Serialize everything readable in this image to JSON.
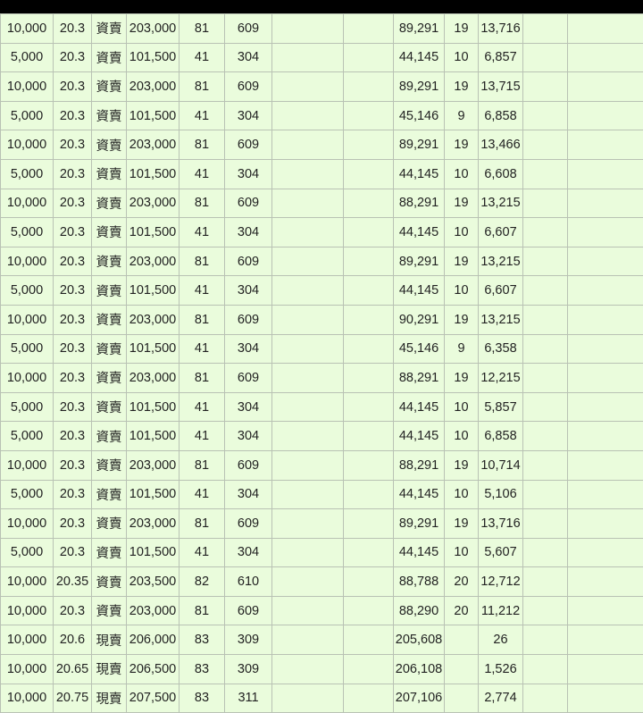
{
  "rows": [
    {
      "qty": "10,000",
      "price": "20.3",
      "type": "資賣",
      "amount": "203,000",
      "fee": "81",
      "tax": "609",
      "e1": "",
      "e2": "",
      "net": "89,291",
      "days": "19",
      "profit": "13,716",
      "e3": "",
      "e4": ""
    },
    {
      "qty": "5,000",
      "price": "20.3",
      "type": "資賣",
      "amount": "101,500",
      "fee": "41",
      "tax": "304",
      "e1": "",
      "e2": "",
      "net": "44,145",
      "days": "10",
      "profit": "6,857",
      "e3": "",
      "e4": ""
    },
    {
      "qty": "10,000",
      "price": "20.3",
      "type": "資賣",
      "amount": "203,000",
      "fee": "81",
      "tax": "609",
      "e1": "",
      "e2": "",
      "net": "89,291",
      "days": "19",
      "profit": "13,715",
      "e3": "",
      "e4": ""
    },
    {
      "qty": "5,000",
      "price": "20.3",
      "type": "資賣",
      "amount": "101,500",
      "fee": "41",
      "tax": "304",
      "e1": "",
      "e2": "",
      "net": "45,146",
      "days": "9",
      "profit": "6,858",
      "e3": "",
      "e4": ""
    },
    {
      "qty": "10,000",
      "price": "20.3",
      "type": "資賣",
      "amount": "203,000",
      "fee": "81",
      "tax": "609",
      "e1": "",
      "e2": "",
      "net": "89,291",
      "days": "19",
      "profit": "13,466",
      "e3": "",
      "e4": ""
    },
    {
      "qty": "5,000",
      "price": "20.3",
      "type": "資賣",
      "amount": "101,500",
      "fee": "41",
      "tax": "304",
      "e1": "",
      "e2": "",
      "net": "44,145",
      "days": "10",
      "profit": "6,608",
      "e3": "",
      "e4": ""
    },
    {
      "qty": "10,000",
      "price": "20.3",
      "type": "資賣",
      "amount": "203,000",
      "fee": "81",
      "tax": "609",
      "e1": "",
      "e2": "",
      "net": "88,291",
      "days": "19",
      "profit": "13,215",
      "e3": "",
      "e4": ""
    },
    {
      "qty": "5,000",
      "price": "20.3",
      "type": "資賣",
      "amount": "101,500",
      "fee": "41",
      "tax": "304",
      "e1": "",
      "e2": "",
      "net": "44,145",
      "days": "10",
      "profit": "6,607",
      "e3": "",
      "e4": ""
    },
    {
      "qty": "10,000",
      "price": "20.3",
      "type": "資賣",
      "amount": "203,000",
      "fee": "81",
      "tax": "609",
      "e1": "",
      "e2": "",
      "net": "89,291",
      "days": "19",
      "profit": "13,215",
      "e3": "",
      "e4": ""
    },
    {
      "qty": "5,000",
      "price": "20.3",
      "type": "資賣",
      "amount": "101,500",
      "fee": "41",
      "tax": "304",
      "e1": "",
      "e2": "",
      "net": "44,145",
      "days": "10",
      "profit": "6,607",
      "e3": "",
      "e4": ""
    },
    {
      "qty": "10,000",
      "price": "20.3",
      "type": "資賣",
      "amount": "203,000",
      "fee": "81",
      "tax": "609",
      "e1": "",
      "e2": "",
      "net": "90,291",
      "days": "19",
      "profit": "13,215",
      "e3": "",
      "e4": ""
    },
    {
      "qty": "5,000",
      "price": "20.3",
      "type": "資賣",
      "amount": "101,500",
      "fee": "41",
      "tax": "304",
      "e1": "",
      "e2": "",
      "net": "45,146",
      "days": "9",
      "profit": "6,358",
      "e3": "",
      "e4": ""
    },
    {
      "qty": "10,000",
      "price": "20.3",
      "type": "資賣",
      "amount": "203,000",
      "fee": "81",
      "tax": "609",
      "e1": "",
      "e2": "",
      "net": "88,291",
      "days": "19",
      "profit": "12,215",
      "e3": "",
      "e4": ""
    },
    {
      "qty": "5,000",
      "price": "20.3",
      "type": "資賣",
      "amount": "101,500",
      "fee": "41",
      "tax": "304",
      "e1": "",
      "e2": "",
      "net": "44,145",
      "days": "10",
      "profit": "5,857",
      "e3": "",
      "e4": ""
    },
    {
      "qty": "5,000",
      "price": "20.3",
      "type": "資賣",
      "amount": "101,500",
      "fee": "41",
      "tax": "304",
      "e1": "",
      "e2": "",
      "net": "44,145",
      "days": "10",
      "profit": "6,858",
      "e3": "",
      "e4": ""
    },
    {
      "qty": "10,000",
      "price": "20.3",
      "type": "資賣",
      "amount": "203,000",
      "fee": "81",
      "tax": "609",
      "e1": "",
      "e2": "",
      "net": "88,291",
      "days": "19",
      "profit": "10,714",
      "e3": "",
      "e4": ""
    },
    {
      "qty": "5,000",
      "price": "20.3",
      "type": "資賣",
      "amount": "101,500",
      "fee": "41",
      "tax": "304",
      "e1": "",
      "e2": "",
      "net": "44,145",
      "days": "10",
      "profit": "5,106",
      "e3": "",
      "e4": ""
    },
    {
      "qty": "10,000",
      "price": "20.3",
      "type": "資賣",
      "amount": "203,000",
      "fee": "81",
      "tax": "609",
      "e1": "",
      "e2": "",
      "net": "89,291",
      "days": "19",
      "profit": "13,716",
      "e3": "",
      "e4": ""
    },
    {
      "qty": "5,000",
      "price": "20.3",
      "type": "資賣",
      "amount": "101,500",
      "fee": "41",
      "tax": "304",
      "e1": "",
      "e2": "",
      "net": "44,145",
      "days": "10",
      "profit": "5,607",
      "e3": "",
      "e4": ""
    },
    {
      "qty": "10,000",
      "price": "20.35",
      "type": "資賣",
      "amount": "203,500",
      "fee": "82",
      "tax": "610",
      "e1": "",
      "e2": "",
      "net": "88,788",
      "days": "20",
      "profit": "12,712",
      "e3": "",
      "e4": ""
    },
    {
      "qty": "10,000",
      "price": "20.3",
      "type": "資賣",
      "amount": "203,000",
      "fee": "81",
      "tax": "609",
      "e1": "",
      "e2": "",
      "net": "88,290",
      "days": "20",
      "profit": "11,212",
      "e3": "",
      "e4": ""
    },
    {
      "qty": "10,000",
      "price": "20.6",
      "type": "現賣",
      "amount": "206,000",
      "fee": "83",
      "tax": "309",
      "e1": "",
      "e2": "",
      "net": "205,608",
      "days": "",
      "profit": "26",
      "e3": "",
      "e4": ""
    },
    {
      "qty": "10,000",
      "price": "20.65",
      "type": "現賣",
      "amount": "206,500",
      "fee": "83",
      "tax": "309",
      "e1": "",
      "e2": "",
      "net": "206,108",
      "days": "",
      "profit": "1,526",
      "e3": "",
      "e4": ""
    },
    {
      "qty": "10,000",
      "price": "20.75",
      "type": "現賣",
      "amount": "207,500",
      "fee": "83",
      "tax": "311",
      "e1": "",
      "e2": "",
      "net": "207,106",
      "days": "",
      "profit": "2,774",
      "e3": "",
      "e4": ""
    }
  ],
  "colors": {
    "background": "#eafcdc",
    "grid": "#b9c2b4",
    "type_text": "#2e8f2e",
    "red_text": "#e0302a",
    "status_bar": "#000000"
  }
}
